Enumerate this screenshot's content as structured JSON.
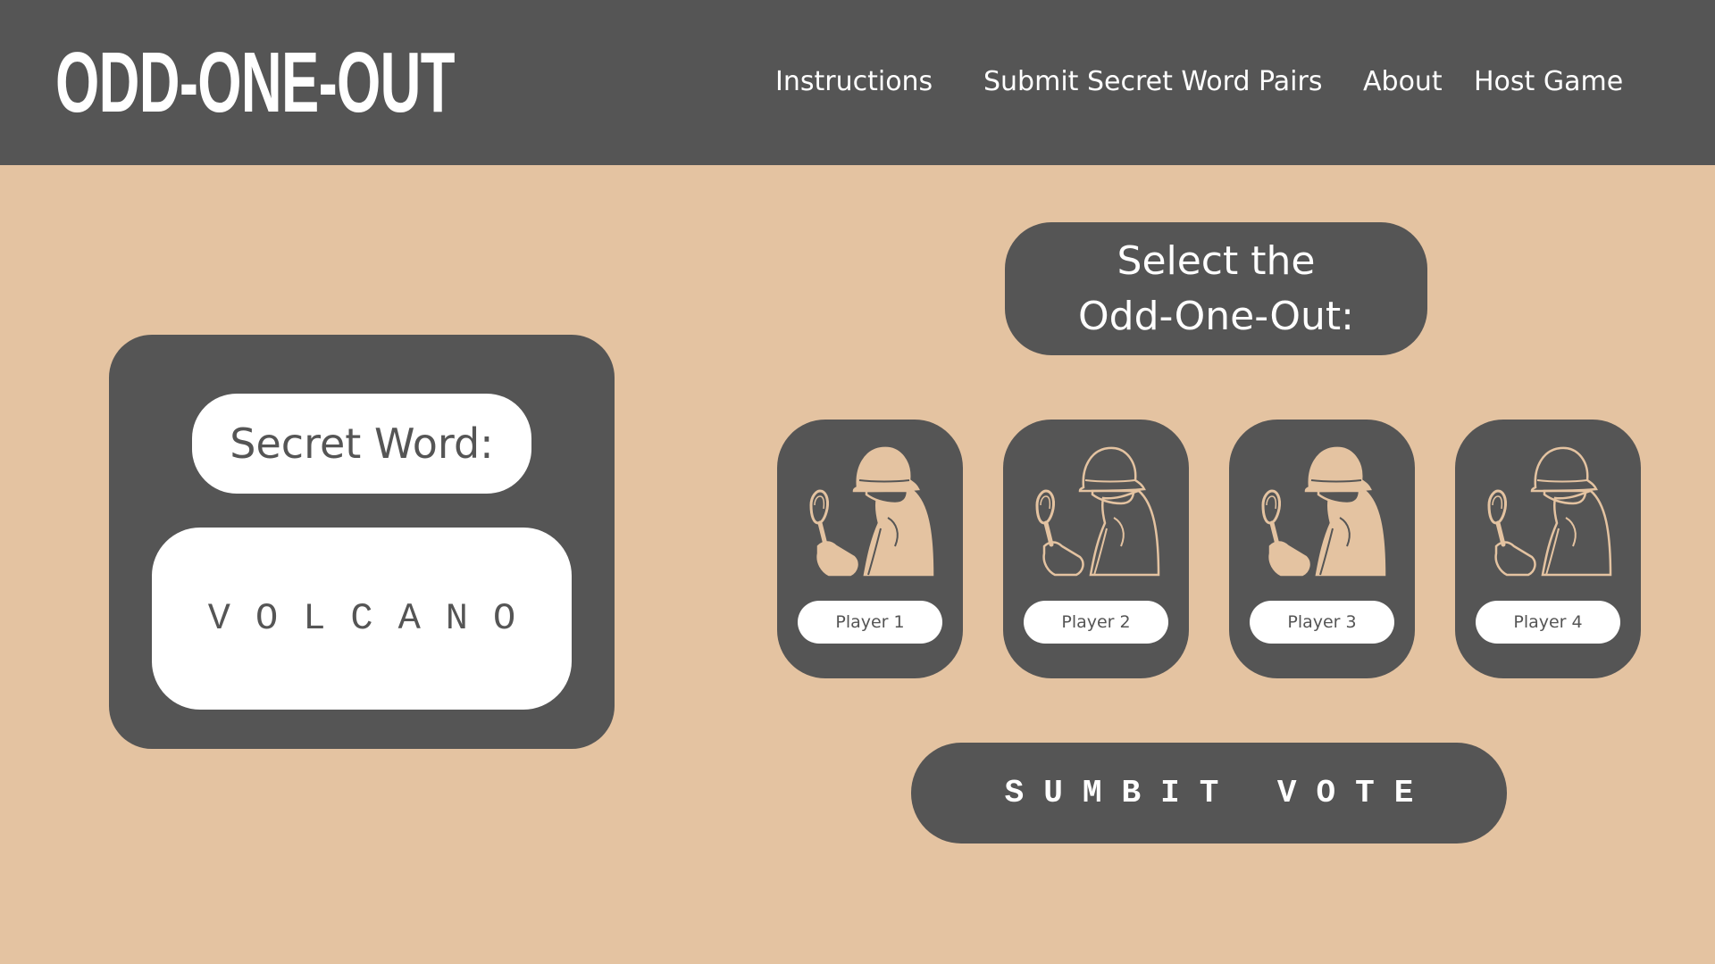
{
  "header": {
    "logo": "ODD-ONE-OUT",
    "nav": [
      {
        "label": "Instructions"
      },
      {
        "label": "Submit Secret Word Pairs"
      },
      {
        "label": "About"
      },
      {
        "label": "Host Game"
      }
    ]
  },
  "secret": {
    "label": "Secret Word:",
    "word": "VOLCANO"
  },
  "vote": {
    "prompt_line1": "Select the",
    "prompt_line2": "Odd-One-Out:",
    "players": [
      {
        "name": "Player 1",
        "icon": "detective-icon",
        "style": "filled"
      },
      {
        "name": "Player 2",
        "icon": "detective-icon",
        "style": "outline"
      },
      {
        "name": "Player 3",
        "icon": "detective-icon",
        "style": "filled"
      },
      {
        "name": "Player 4",
        "icon": "detective-icon",
        "style": "outline"
      }
    ],
    "submit_label": "SUMBIT VOTE"
  },
  "colors": {
    "background": "#e4c3a1",
    "panel": "#555555",
    "accent": "#e4c3a1",
    "text_light": "#ffffff"
  }
}
